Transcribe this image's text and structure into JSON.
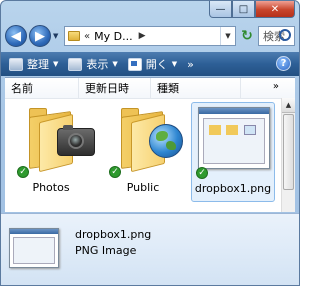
{
  "window": {
    "caption_min": "—",
    "caption_max": "□",
    "caption_close": "✕"
  },
  "nav": {
    "back_glyph": "◀",
    "forward_glyph": "▶",
    "dropdown_glyph": "▼",
    "address_chevron": "«",
    "address_path": "My D...",
    "address_sep": "▶",
    "address_dd": "▼",
    "refresh_glyph": "↻",
    "search_placeholder": "検索"
  },
  "toolbar": {
    "organize": "整理",
    "views": "表示",
    "open": "開く",
    "arrow": "▼",
    "more": "»",
    "help": "?"
  },
  "columns": {
    "name": "名前",
    "date": "更新日時",
    "type": "種類",
    "more": "»"
  },
  "scroll": {
    "up": "▲"
  },
  "items": [
    {
      "label": "Photos",
      "icon": "folder-camera-icon",
      "status": "sync-ok"
    },
    {
      "label": "Public",
      "icon": "folder-globe-icon",
      "status": "sync-ok"
    },
    {
      "label": "dropbox1.png",
      "icon": "image-thumbnail-icon",
      "status": "sync-ok",
      "selected": true
    }
  ],
  "check_glyph": "✓",
  "details": {
    "name": "dropbox1.png",
    "type": "PNG Image"
  }
}
